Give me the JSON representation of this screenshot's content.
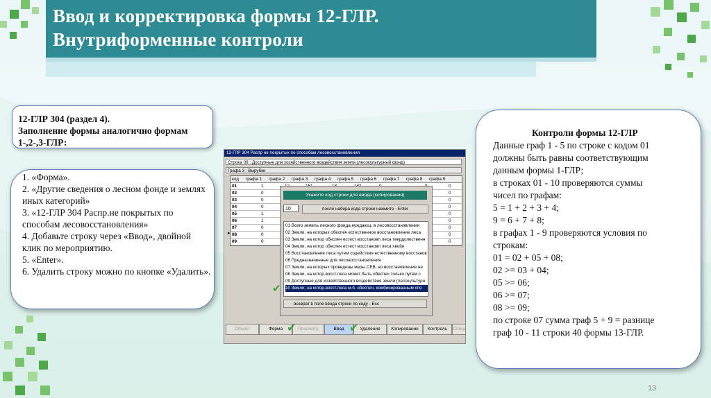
{
  "title": {
    "line1": "Ввод и корректировка формы 12-ГЛР.",
    "line2": "Внутриформенные контроли"
  },
  "box_top": {
    "line1": "12-ГЛР 304 (раздел 4).",
    "line2": "Заполнение формы аналогично формам",
    "line3": "1-,2-,3-ГЛР:"
  },
  "steps": [
    "1.      «Форма».",
    "2.      «Другие сведения о лесном фонде и землях иных категорий»",
    "3.      «12-ГЛР 304 Распр.не покрытых по способам лесовосстановления»",
    "4.      Добавьте строку через «Ввод», двойной клик по  мероприятию.",
    "5.      «Enter».",
    "6.      Удалить строку можно по кнопке «Удалить»."
  ],
  "controls": {
    "heading": "Контроли формы 12-ГЛР",
    "lines": [
      "Данные граф 1 - 5 по строке с кодом 01",
      "должны быть равны соответствующим",
      "данным формы 1-ГЛР;",
      "в строках 01 - 10 проверяются суммы",
      "чисел по графам:",
      "5 = 1 + 2 + 3 + 4;",
      "9 = 6 + 7 + 8;",
      "в графах 1 - 9 проверяются условия по",
      "строкам:",
      "01 = 02 + 05 + 08;",
      "02 >= 03 + 04;",
      "05 >= 06;",
      "06 >= 07;",
      "08 >= 09;",
      "по строке 07 сумма граф 5 + 9 = разнице",
      "граф 10 - 11 строки 40 формы 13-ГЛР."
    ]
  },
  "page_number": "13",
  "screenshot": {
    "caption": "12-ГЛР 304   Распр не покрытых по способам лесовосстановления",
    "row1": "Строка 09 :  Доступные для хозяйственного воздействия земли (лесокультурный фонд)",
    "row2": "Графа 3 :  Вырубки",
    "headers": [
      "код",
      "графа 1",
      "графа 2",
      "графа 3",
      "графа 4",
      "графа 5",
      "графа 6",
      "графа 7",
      "графа 8",
      "графа 9"
    ],
    "rows": [
      {
        "code": "01",
        "v1": "1",
        "v3": "12",
        "v4": "151",
        "v5": "18",
        "v6": "187",
        "v7": "0",
        "v8": "0",
        "v9": "0"
      },
      {
        "code": "02",
        "v1": "0",
        "v9": "0"
      },
      {
        "code": "03",
        "v1": "0",
        "v9": "0"
      },
      {
        "code": "04",
        "v1": "0",
        "v9": "0"
      },
      {
        "code": "05",
        "v1": "1",
        "v9": "0"
      },
      {
        "code": "06",
        "v1": "1",
        "v9": "0"
      },
      {
        "code": "07",
        "v1": "0",
        "v9": "0"
      },
      {
        "code": "08",
        "v1": "0",
        "v9": "0"
      },
      {
        "code": "09",
        "v1": "0",
        "v9": "0"
      }
    ],
    "dialog": {
      "caption": "Укажите код строки для ввода (копирования)",
      "input_value": "10",
      "hint_button": "после набора кода строки нажмите - Enter",
      "items": [
        "01 Всего земель лесного фонда,нуждающ. в лесовосстановлении",
        "02 Земли, на которых обеспеч естественное восстановление леса",
        "03 Земли, на котор обеспеч естест восстановл леса твердолиственн",
        "04 Земли, на котор обеспеч естест восстановл леса хвойн",
        "05 Восстановление леса путем содействия естественному  восстанов",
        "06 Предназначенные для лесовосстановления",
        "07 Земли, на которых проведены меры СЕВ, но восстановление не",
        "08 Земли, на котор.восст.леса может быть обеспеч только путем с",
        "09 Доступные для хозяйственного воздействия земли (лесокультурн",
        "10 Земли, на котор.восст.леса м.б. обеспеч. комбинированным спо"
      ],
      "back_button": "возврат в поле ввода строки по коду  - Esc"
    },
    "buttons": [
      "Объект",
      "Форма",
      "Просмотр",
      "Ввод",
      "Удаление",
      "Копирование",
      "Контроль",
      "Специ"
    ],
    "check_glyph": "✔"
  }
}
